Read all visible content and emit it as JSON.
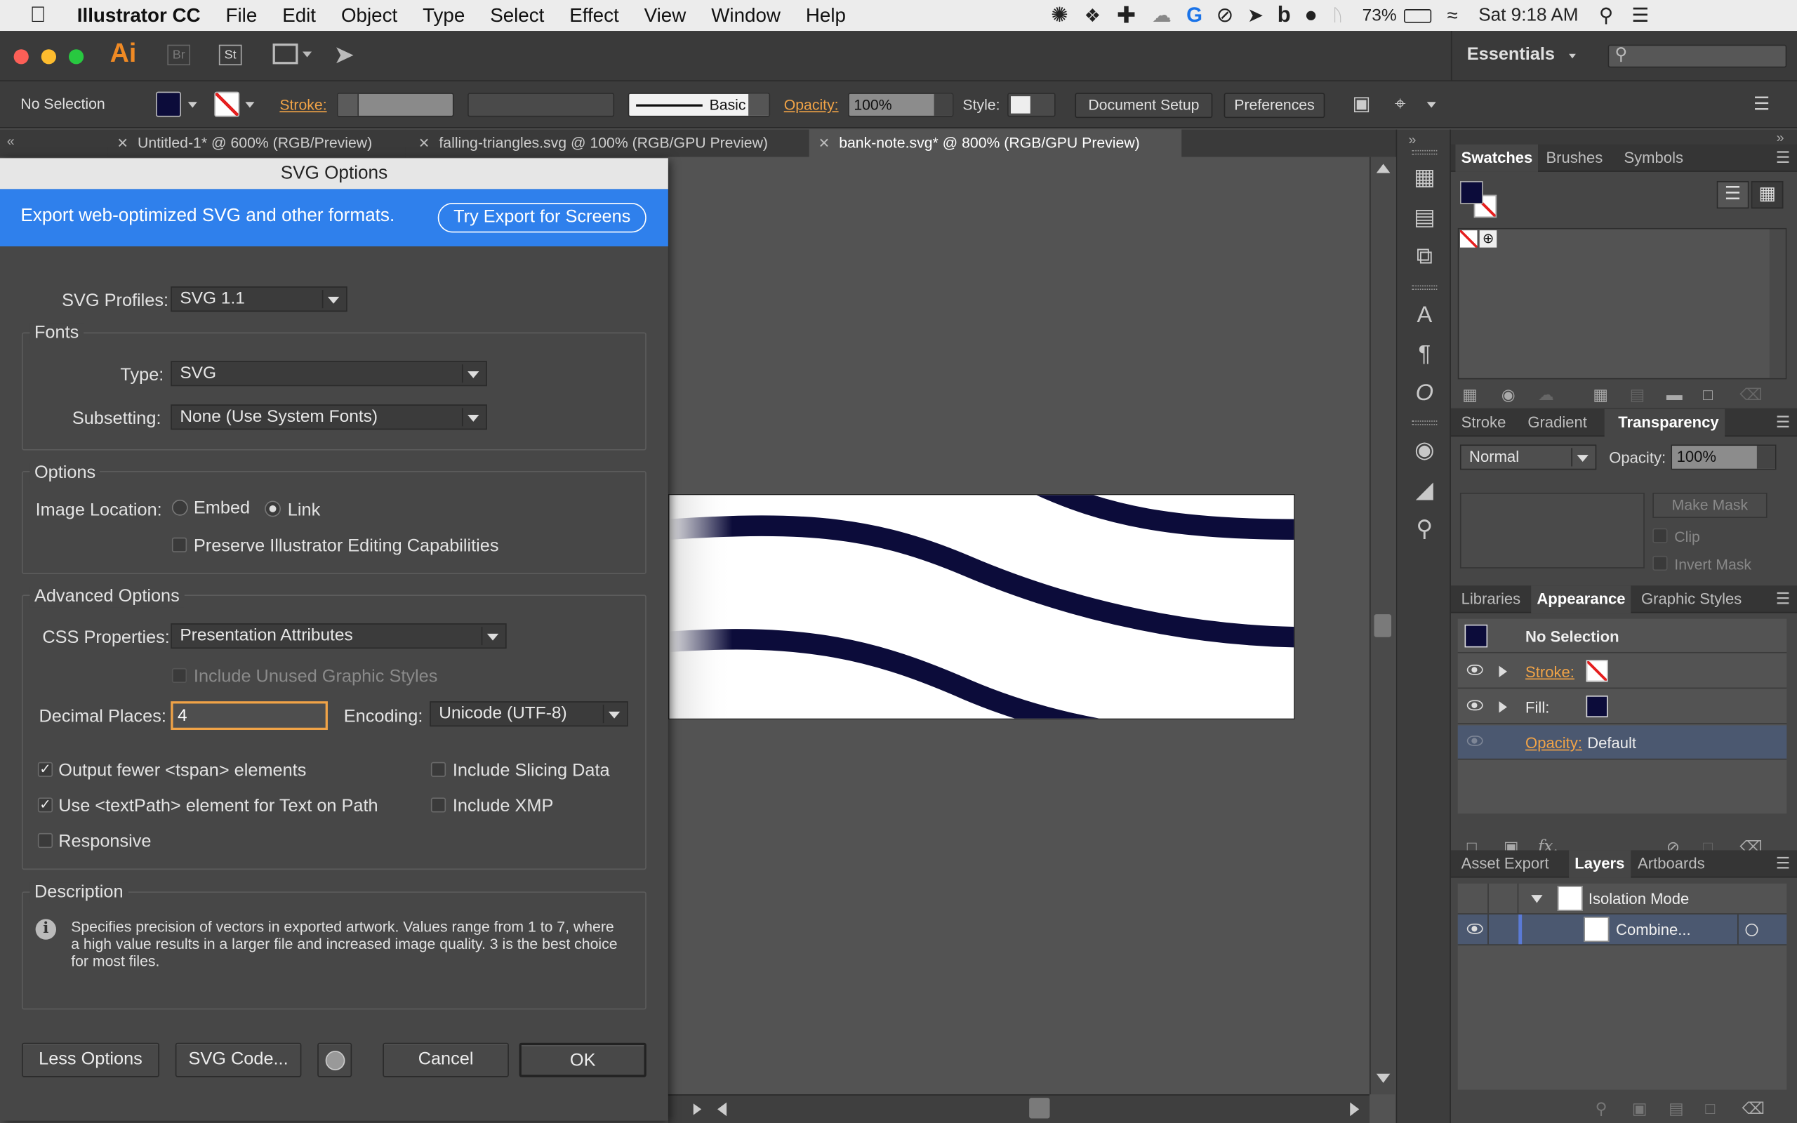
{
  "menubar": {
    "app_name": "Illustrator CC",
    "items": [
      "File",
      "Edit",
      "Object",
      "Type",
      "Select",
      "Effect",
      "View",
      "Window",
      "Help"
    ],
    "battery": "73%",
    "clock": "Sat 9:18 AM"
  },
  "appbar": {
    "logo": "Ai",
    "bridge": "Br",
    "stock": "St",
    "workspace": "Essentials"
  },
  "control": {
    "selection": "No Selection",
    "stroke_label": "Stroke:",
    "brush_label": "Basic",
    "opacity_label": "Opacity:",
    "opacity_value": "100%",
    "style_label": "Style:",
    "doc_setup": "Document Setup",
    "preferences": "Preferences"
  },
  "tabs": [
    {
      "label": "Untitled-1* @ 600% (RGB/Preview)"
    },
    {
      "label": "falling-triangles.svg @ 100% (RGB/GPU Preview)"
    },
    {
      "label": "bank-note.svg* @ 800% (RGB/GPU Preview)"
    }
  ],
  "dialog": {
    "title": "SVG Options",
    "banner_text": "Export web-optimized SVG and other formats.",
    "banner_button": "Try Export for Screens",
    "svg_profiles_label": "SVG Profiles:",
    "svg_profiles_value": "SVG 1.1",
    "fonts_group": "Fonts",
    "type_label": "Type:",
    "type_value": "SVG",
    "subsetting_label": "Subsetting:",
    "subsetting_value": "None (Use System Fonts)",
    "options_group": "Options",
    "image_location_label": "Image Location:",
    "embed_label": "Embed",
    "link_label": "Link",
    "image_location_selected": "Link",
    "preserve_label": "Preserve Illustrator Editing Capabilities",
    "preserve_checked": false,
    "advanced_group": "Advanced Options",
    "css_label": "CSS Properties:",
    "css_value": "Presentation Attributes",
    "unused_styles_label": "Include Unused Graphic Styles",
    "decimal_label": "Decimal Places:",
    "decimal_value": "4",
    "encoding_label": "Encoding:",
    "encoding_value": "Unicode (UTF-8)",
    "tspan_label": "Output fewer <tspan> elements",
    "textpath_label": "Use <textPath> element for Text on Path",
    "responsive_label": "Responsive",
    "slicing_label": "Include Slicing Data",
    "xmp_label": "Include XMP",
    "description_group": "Description",
    "description_text": "Specifies precision of vectors in exported artwork. Values range from 1 to 7, where a high value results in a larger file and increased image quality. 3 is the best choice for most files.",
    "less_options": "Less Options",
    "svg_code": "SVG Code...",
    "cancel": "Cancel",
    "ok": "OK"
  },
  "panels": {
    "swatches_tabs": [
      "Swatches",
      "Brushes",
      "Symbols"
    ],
    "transparency_tabs": [
      "Stroke",
      "Gradient",
      "Transparency"
    ],
    "blend_mode": "Normal",
    "opacity_label": "Opacity:",
    "opacity_value": "100%",
    "make_mask": "Make Mask",
    "clip": "Clip",
    "invert_mask": "Invert Mask",
    "appearance_tabs": [
      "Libraries",
      "Appearance",
      "Graphic Styles"
    ],
    "appearance_title": "No Selection",
    "stroke_label": "Stroke:",
    "fill_label": "Fill:",
    "opacity_row_label": "Opacity:",
    "opacity_row_value": "Default",
    "fx_label": "fx.",
    "layers_tabs": [
      "Asset Export",
      "Layers",
      "Artboards"
    ],
    "layer_isolation": "Isolation Mode",
    "layer_item": "Combine..."
  },
  "colors": {
    "accent_blue": "#2f80ec",
    "navy": "#0c0c3a",
    "orange_label": "#f0a347"
  }
}
